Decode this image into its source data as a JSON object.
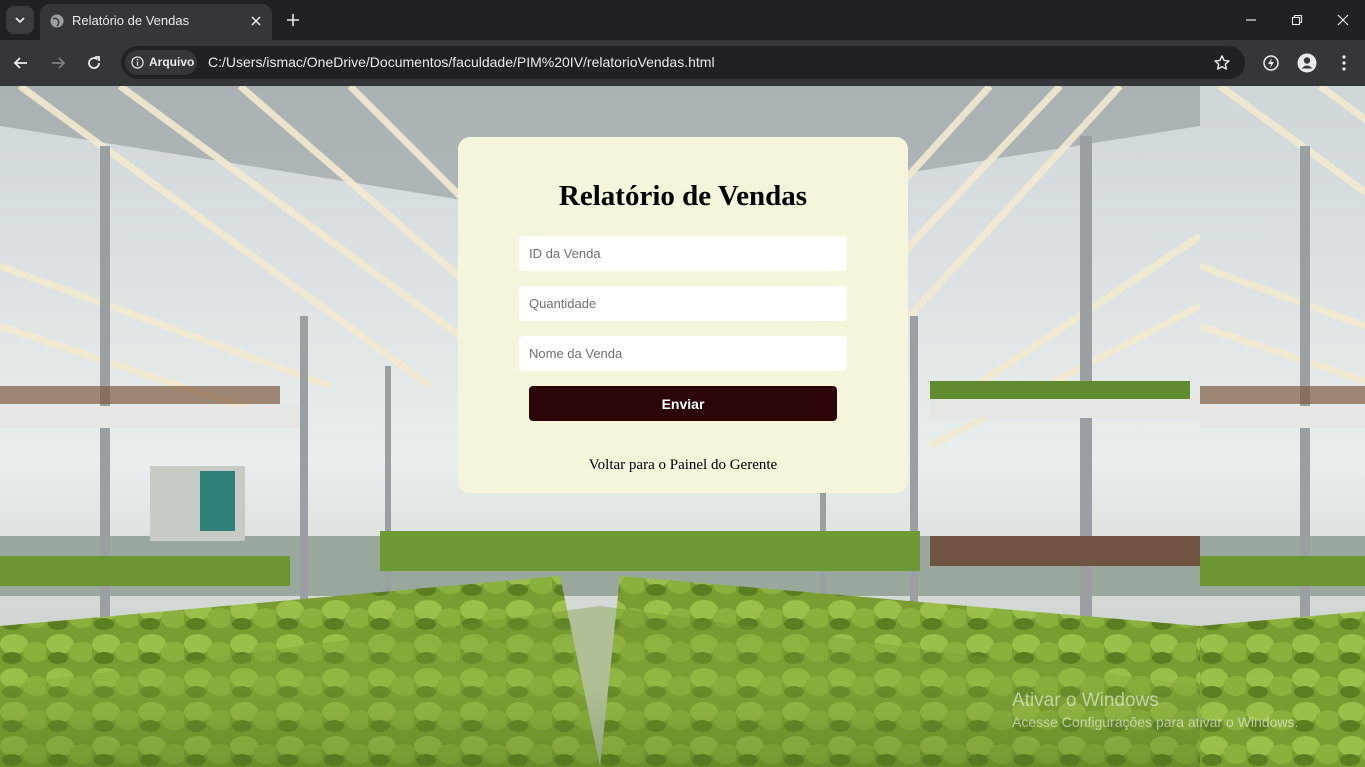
{
  "browser": {
    "tab": {
      "title": "Relatório de Vendas"
    },
    "security_chip": "Arquivo",
    "url": "C:/Users/ismac/OneDrive/Documentos/faculdade/PIM%20IV/relatorioVendas.html",
    "icons": [
      "chevron-down-icon",
      "globe-icon",
      "close-icon",
      "plus-icon",
      "minimize-icon",
      "restore-icon",
      "back-icon",
      "forward-icon",
      "reload-icon",
      "info-icon",
      "star-icon",
      "extensions-icon",
      "profile-icon",
      "menu-icon"
    ]
  },
  "page": {
    "title": "Relatório de Vendas",
    "fields": {
      "id_placeholder": "ID da Venda",
      "quantity_placeholder": "Quantidade",
      "name_placeholder": "Nome da Venda"
    },
    "submit_label": "Enviar",
    "back_link": "Voltar para o Painel do Gerente",
    "card_color": "#f5f5dc",
    "button_color": "#2b0508"
  },
  "watermark": {
    "title": "Ativar o Windows",
    "subtitle": "Acesse Configurações para ativar o Windows."
  }
}
